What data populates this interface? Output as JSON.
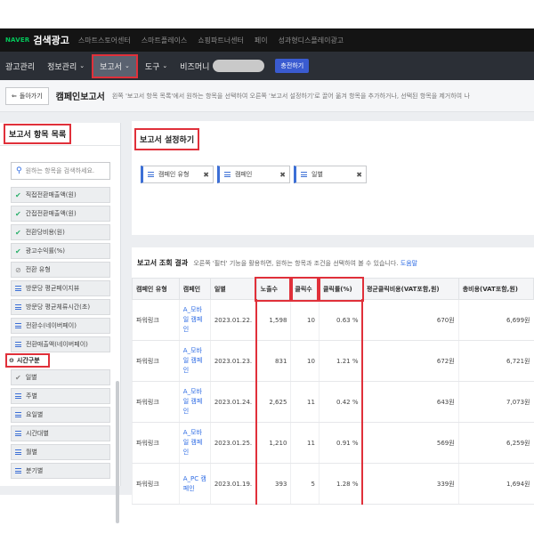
{
  "topbar": {
    "logo": "NAVER",
    "product": "검색광고",
    "links": [
      "스마트스토어센터",
      "스마트플레이스",
      "쇼핑파트너센터",
      "페이",
      "성과형디스플레이광고"
    ]
  },
  "navbar": {
    "items": [
      {
        "label": "광고관리"
      },
      {
        "label": "정보관리",
        "caret": "⌄"
      },
      {
        "label": "보고서",
        "caret": "⌄"
      },
      {
        "label": "도구",
        "caret": "⌄"
      }
    ],
    "biz_label": "비즈머니",
    "switch_label": "충전하기"
  },
  "header": {
    "back_label": "돌아가기",
    "title": "캠페인보고서",
    "desc": "왼쪽 '보고서 항목 목록'에서 원하는 항목을 선택하여 오른쪽 '보고서 설정하기'로 끌어 옮겨 항목을 추가하거나, 선택된 항목을 제거하여 나"
  },
  "left_panel": {
    "title": "보고서 항목 목록",
    "search_placeholder": "원하는 항목을 검색하세요.",
    "items": [
      {
        "label": "직접전환매출액(원)",
        "icon": "check"
      },
      {
        "label": "간접전환매출액(원)",
        "icon": "check"
      },
      {
        "label": "전환당비용(원)",
        "icon": "check"
      },
      {
        "label": "광고수익률(%)",
        "icon": "check"
      },
      {
        "label": "전환 유형",
        "icon": "ban"
      },
      {
        "label": "방문당 평균페이지뷰",
        "icon": "menu"
      },
      {
        "label": "방문당 평균체류시간(초)",
        "icon": "menu"
      },
      {
        "label": "전환수(네이버페이)",
        "icon": "menu"
      },
      {
        "label": "전환매출액(네이버페이)",
        "icon": "menu"
      }
    ],
    "section_label": "시간구분",
    "time_items": [
      {
        "label": "일별",
        "icon": "check"
      },
      {
        "label": "주별",
        "icon": "menu"
      },
      {
        "label": "요일별",
        "icon": "menu"
      },
      {
        "label": "시간대별",
        "icon": "menu"
      },
      {
        "label": "월별",
        "icon": "menu"
      },
      {
        "label": "분기별",
        "icon": "menu"
      }
    ]
  },
  "settings": {
    "title": "보고서 설정하기",
    "chips": [
      "캠페인 유형",
      "캠페인",
      "일별"
    ]
  },
  "results": {
    "title": "보고서 조회 결과",
    "desc": "오른쪽 '필터' 기능을 활용하면, 원하는 항목과 조건을 선택하여 볼 수 있습니다.",
    "help_label": "도움말",
    "columns": [
      "캠페인 유형",
      "캠페인",
      "일별",
      "노출수",
      "클릭수",
      "클릭률(%)",
      "평균클릭비용(VAT포함,원)",
      "총비용(VAT포함,원)"
    ],
    "rows": [
      {
        "type": "파워링크",
        "campaign": "A_모바일 캠페인",
        "date": "2023.01.22.",
        "impressions": "1,598",
        "clicks": "10",
        "ctr": "0.63 %",
        "cpc": "670원",
        "cost": "6,699원"
      },
      {
        "type": "파워링크",
        "campaign": "A_모바일 캠페인",
        "date": "2023.01.23.",
        "impressions": "831",
        "clicks": "10",
        "ctr": "1.21 %",
        "cpc": "672원",
        "cost": "6,721원"
      },
      {
        "type": "파워링크",
        "campaign": "A_모바일 캠페인",
        "date": "2023.01.24.",
        "impressions": "2,625",
        "clicks": "11",
        "ctr": "0.42 %",
        "cpc": "643원",
        "cost": "7,073원"
      },
      {
        "type": "파워링크",
        "campaign": "A_모바일 캠페인",
        "date": "2023.01.25.",
        "impressions": "1,210",
        "clicks": "11",
        "ctr": "0.91 %",
        "cpc": "569원",
        "cost": "6,259원"
      },
      {
        "type": "파워링크",
        "campaign": "A_PC 캠페인",
        "date": "2023.01.19.",
        "impressions": "393",
        "clicks": "5",
        "ctr": "1.28 %",
        "cpc": "339원",
        "cost": "1,694원"
      }
    ]
  }
}
